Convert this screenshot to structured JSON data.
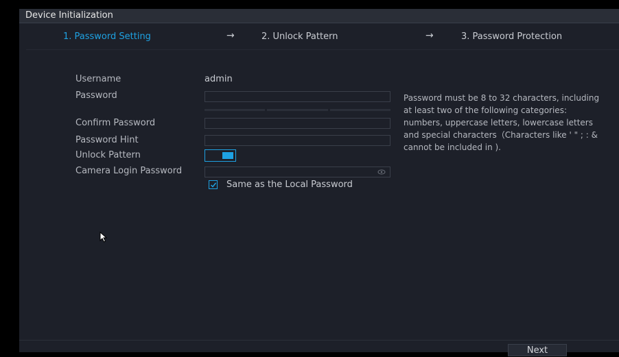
{
  "window": {
    "title": "Device Initialization"
  },
  "steps": [
    {
      "label": "1.  Password Setting",
      "active": true
    },
    {
      "label": "2.  Unlock Pattern",
      "active": false
    },
    {
      "label": "3.  Password Protection",
      "active": false
    }
  ],
  "step_separator": "→",
  "form": {
    "username_label": "Username",
    "username_value": "admin",
    "password_label": "Password",
    "password_value": "",
    "confirm_label": "Confirm Password",
    "confirm_value": "",
    "hint_label": "Password Hint",
    "hint_value": "",
    "unlock_label": "Unlock Pattern",
    "unlock_enabled": true,
    "camera_label": "Camera Login Password",
    "camera_value": "",
    "same_as_local_label": "Same as the Local Password",
    "same_as_local_checked": true
  },
  "password_rules": [
    "Password must be 8 to 32 characters, including",
    "at least two of the following categories:",
    "numbers, uppercase letters, lowercase letters",
    "and special characters（Characters like ' \" ; : &",
    "cannot be included in )."
  ],
  "footer": {
    "next_label": "Next"
  },
  "colors": {
    "accent": "#1ea2e3",
    "panel": "#1d2029",
    "title_bar": "#2a2e37"
  }
}
